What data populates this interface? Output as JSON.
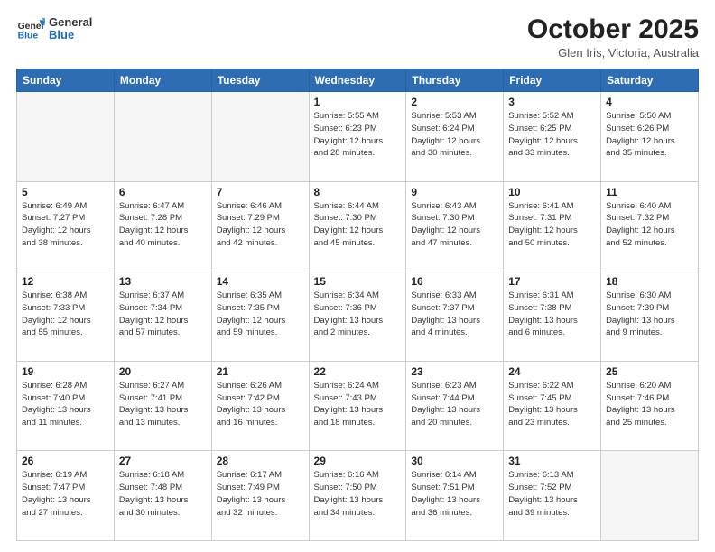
{
  "header": {
    "logo_general": "General",
    "logo_blue": "Blue",
    "month_title": "October 2025",
    "subtitle": "Glen Iris, Victoria, Australia"
  },
  "days_of_week": [
    "Sunday",
    "Monday",
    "Tuesday",
    "Wednesday",
    "Thursday",
    "Friday",
    "Saturday"
  ],
  "weeks": [
    [
      {
        "day": "",
        "info": ""
      },
      {
        "day": "",
        "info": ""
      },
      {
        "day": "",
        "info": ""
      },
      {
        "day": "1",
        "info": "Sunrise: 5:55 AM\nSunset: 6:23 PM\nDaylight: 12 hours\nand 28 minutes."
      },
      {
        "day": "2",
        "info": "Sunrise: 5:53 AM\nSunset: 6:24 PM\nDaylight: 12 hours\nand 30 minutes."
      },
      {
        "day": "3",
        "info": "Sunrise: 5:52 AM\nSunset: 6:25 PM\nDaylight: 12 hours\nand 33 minutes."
      },
      {
        "day": "4",
        "info": "Sunrise: 5:50 AM\nSunset: 6:26 PM\nDaylight: 12 hours\nand 35 minutes."
      }
    ],
    [
      {
        "day": "5",
        "info": "Sunrise: 6:49 AM\nSunset: 7:27 PM\nDaylight: 12 hours\nand 38 minutes."
      },
      {
        "day": "6",
        "info": "Sunrise: 6:47 AM\nSunset: 7:28 PM\nDaylight: 12 hours\nand 40 minutes."
      },
      {
        "day": "7",
        "info": "Sunrise: 6:46 AM\nSunset: 7:29 PM\nDaylight: 12 hours\nand 42 minutes."
      },
      {
        "day": "8",
        "info": "Sunrise: 6:44 AM\nSunset: 7:30 PM\nDaylight: 12 hours\nand 45 minutes."
      },
      {
        "day": "9",
        "info": "Sunrise: 6:43 AM\nSunset: 7:30 PM\nDaylight: 12 hours\nand 47 minutes."
      },
      {
        "day": "10",
        "info": "Sunrise: 6:41 AM\nSunset: 7:31 PM\nDaylight: 12 hours\nand 50 minutes."
      },
      {
        "day": "11",
        "info": "Sunrise: 6:40 AM\nSunset: 7:32 PM\nDaylight: 12 hours\nand 52 minutes."
      }
    ],
    [
      {
        "day": "12",
        "info": "Sunrise: 6:38 AM\nSunset: 7:33 PM\nDaylight: 12 hours\nand 55 minutes."
      },
      {
        "day": "13",
        "info": "Sunrise: 6:37 AM\nSunset: 7:34 PM\nDaylight: 12 hours\nand 57 minutes."
      },
      {
        "day": "14",
        "info": "Sunrise: 6:35 AM\nSunset: 7:35 PM\nDaylight: 12 hours\nand 59 minutes."
      },
      {
        "day": "15",
        "info": "Sunrise: 6:34 AM\nSunset: 7:36 PM\nDaylight: 13 hours\nand 2 minutes."
      },
      {
        "day": "16",
        "info": "Sunrise: 6:33 AM\nSunset: 7:37 PM\nDaylight: 13 hours\nand 4 minutes."
      },
      {
        "day": "17",
        "info": "Sunrise: 6:31 AM\nSunset: 7:38 PM\nDaylight: 13 hours\nand 6 minutes."
      },
      {
        "day": "18",
        "info": "Sunrise: 6:30 AM\nSunset: 7:39 PM\nDaylight: 13 hours\nand 9 minutes."
      }
    ],
    [
      {
        "day": "19",
        "info": "Sunrise: 6:28 AM\nSunset: 7:40 PM\nDaylight: 13 hours\nand 11 minutes."
      },
      {
        "day": "20",
        "info": "Sunrise: 6:27 AM\nSunset: 7:41 PM\nDaylight: 13 hours\nand 13 minutes."
      },
      {
        "day": "21",
        "info": "Sunrise: 6:26 AM\nSunset: 7:42 PM\nDaylight: 13 hours\nand 16 minutes."
      },
      {
        "day": "22",
        "info": "Sunrise: 6:24 AM\nSunset: 7:43 PM\nDaylight: 13 hours\nand 18 minutes."
      },
      {
        "day": "23",
        "info": "Sunrise: 6:23 AM\nSunset: 7:44 PM\nDaylight: 13 hours\nand 20 minutes."
      },
      {
        "day": "24",
        "info": "Sunrise: 6:22 AM\nSunset: 7:45 PM\nDaylight: 13 hours\nand 23 minutes."
      },
      {
        "day": "25",
        "info": "Sunrise: 6:20 AM\nSunset: 7:46 PM\nDaylight: 13 hours\nand 25 minutes."
      }
    ],
    [
      {
        "day": "26",
        "info": "Sunrise: 6:19 AM\nSunset: 7:47 PM\nDaylight: 13 hours\nand 27 minutes."
      },
      {
        "day": "27",
        "info": "Sunrise: 6:18 AM\nSunset: 7:48 PM\nDaylight: 13 hours\nand 30 minutes."
      },
      {
        "day": "28",
        "info": "Sunrise: 6:17 AM\nSunset: 7:49 PM\nDaylight: 13 hours\nand 32 minutes."
      },
      {
        "day": "29",
        "info": "Sunrise: 6:16 AM\nSunset: 7:50 PM\nDaylight: 13 hours\nand 34 minutes."
      },
      {
        "day": "30",
        "info": "Sunrise: 6:14 AM\nSunset: 7:51 PM\nDaylight: 13 hours\nand 36 minutes."
      },
      {
        "day": "31",
        "info": "Sunrise: 6:13 AM\nSunset: 7:52 PM\nDaylight: 13 hours\nand 39 minutes."
      },
      {
        "day": "",
        "info": ""
      }
    ]
  ]
}
